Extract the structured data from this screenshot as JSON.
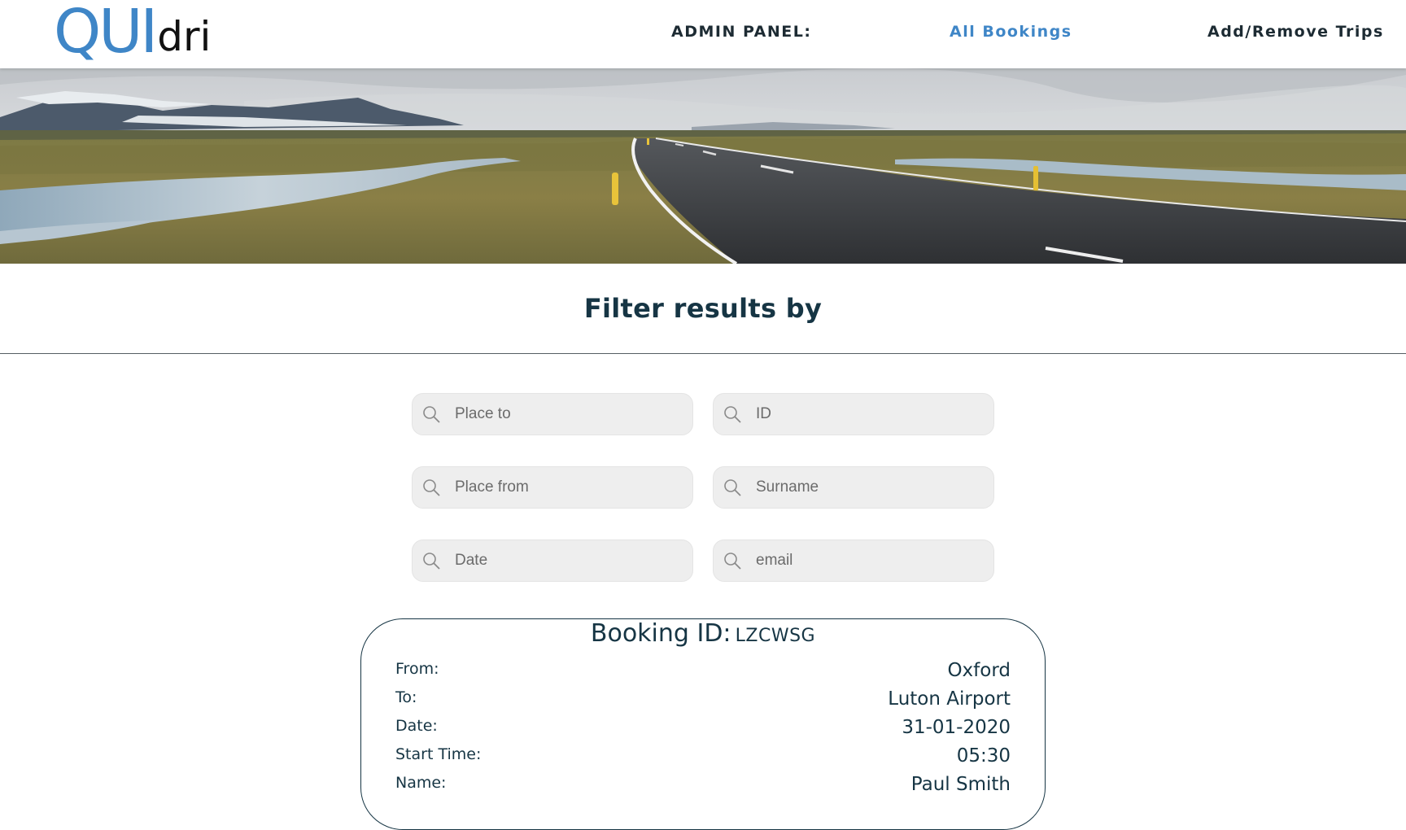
{
  "header": {
    "logo_main": "QUI",
    "logo_sub": "dri",
    "nav": {
      "admin_label": "ADMIN PANEL:",
      "bookings_label": "All Bookings",
      "trips_label": "Add/Remove Trips"
    },
    "active_color": "#3f86c7"
  },
  "filter": {
    "title": "Filter results by",
    "fields": {
      "place_to": "Place to",
      "id": "ID",
      "place_from": "Place from",
      "surname": "Surname",
      "date": "Date",
      "email": "email"
    }
  },
  "booking": {
    "id_label": "Booking ID:",
    "id_value": "LZCWSG",
    "from_label": "From:",
    "from_value": "Oxford",
    "to_label": "To:",
    "to_value": "Luton Airport",
    "date_label": "Date:",
    "date_value": "31-01-2020",
    "time_label": "Start Time:",
    "time_value": "05:30",
    "name_label": "Name:",
    "name_value": "Paul Smith"
  },
  "colors": {
    "primary_text": "#163544",
    "accent": "#3f86c7",
    "field_bg": "#eeeeee"
  }
}
